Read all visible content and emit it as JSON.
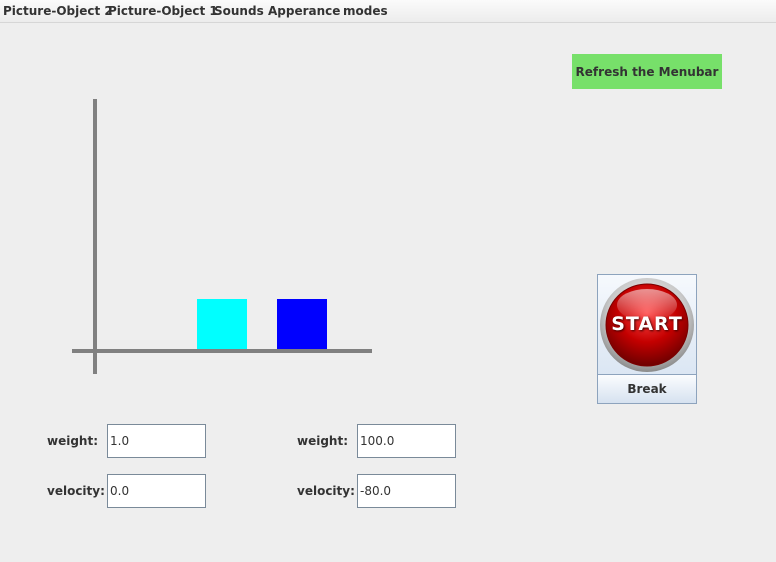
{
  "menubar": {
    "items": [
      {
        "label": "Picture-Object 2"
      },
      {
        "label": "Picture-Object 1"
      },
      {
        "label": "Sounds"
      },
      {
        "label": "Apperance"
      },
      {
        "label": "modes"
      }
    ]
  },
  "refresh_button": {
    "label": "Refresh the Menubar",
    "color": "#77e06a"
  },
  "simulation": {
    "object_1": {
      "color": "#00ffff"
    },
    "object_2": {
      "color": "#0000ff"
    },
    "axis_color": "#808080"
  },
  "controls": {
    "start_label": "START",
    "break_label": "Break"
  },
  "form": {
    "left": {
      "weight_label": "weight:",
      "weight_value": "1.0",
      "velocity_label": "velocity:",
      "velocity_value": "0.0"
    },
    "right": {
      "weight_label": "weight:",
      "weight_value": "100.0",
      "velocity_label": "velocity:",
      "velocity_value": "-80.0"
    }
  }
}
